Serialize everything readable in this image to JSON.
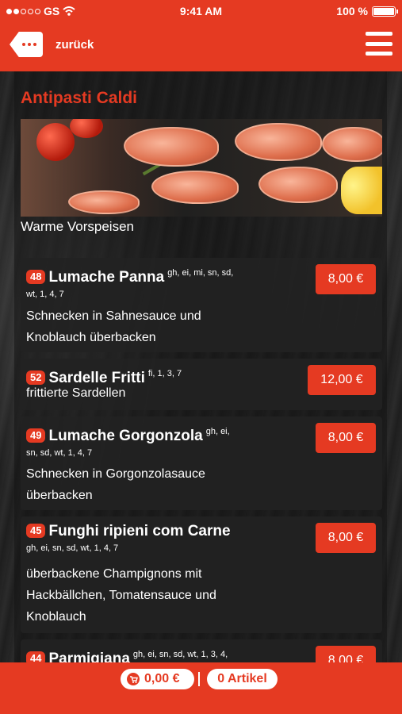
{
  "status_bar": {
    "carrier": "GS",
    "time": "9:41 AM",
    "battery": "100 %",
    "battery_level": 1.0
  },
  "nav": {
    "back_label": "zurück"
  },
  "category": {
    "title": "Antipasti Caldi",
    "subtitle": "Warme Vorspeisen"
  },
  "items": [
    {
      "number": "48",
      "name": "Lumache Panna",
      "allergens_inline": "gh, ei, mi, sn, sd,",
      "allergens_cont": "wt, 1, 4, 7",
      "desc_line1": "Schnecken in Sahnesauce und",
      "desc_line2": "Knoblauch überbacken",
      "price": "8,00 €"
    },
    {
      "number": "52",
      "name": "Sardelle Fritti",
      "allergens_inline": "fi, 1, 3, 7",
      "desc_line1": "frittierte Sardellen",
      "price": "12,00 €"
    },
    {
      "number": "49",
      "name": "Lumache Gorgonzola",
      "allergens_inline": "gh, ei,",
      "allergens_cont": "sn, sd, wt, 1, 4, 7",
      "desc_line1": "Schnecken in Gorgonzolasauce",
      "desc_line2": "überbacken",
      "price": "8,00 €"
    },
    {
      "number": "45",
      "name": "Funghi ripieni com Carne",
      "allergens_cont": "gh, ei, sn, sd, wt, 1, 4, 7",
      "desc_line1": "überbackene Champignons mit",
      "desc_line2": "Hackbällchen, Tomatensauce und",
      "desc_line3": "Knoblauch",
      "price": "8,00 €"
    },
    {
      "number": "44",
      "name": "Parmigiana",
      "allergens_inline": "gh, ei, sn, sd, wt, 1, 3, 4,",
      "price": "8,00 €"
    }
  ],
  "cart": {
    "total": "0,00 €",
    "count": "0 Artikel"
  },
  "colors": {
    "accent": "#e53a22",
    "background": "#1b1b1b"
  }
}
